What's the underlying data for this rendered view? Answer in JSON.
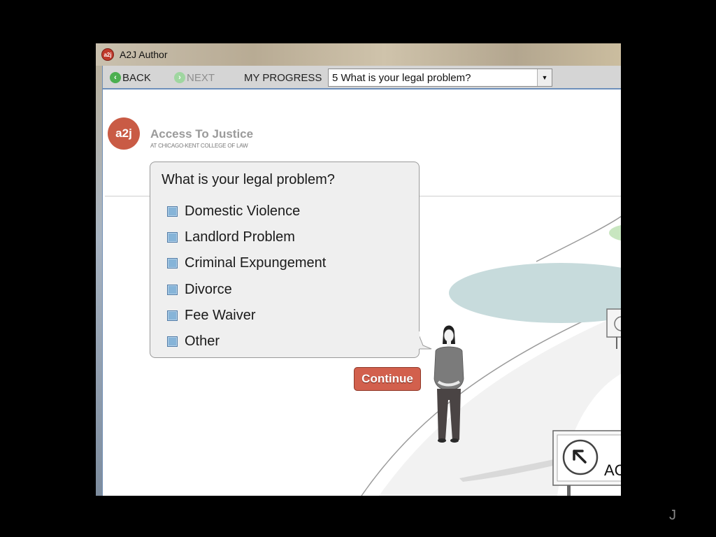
{
  "window": {
    "title": "A2J Author",
    "icon_text": "a2j"
  },
  "nav": {
    "back_label": "BACK",
    "next_label": "NEXT",
    "progress_label": "MY PROGRESS",
    "progress_value": "5 What is your legal problem?"
  },
  "brand": {
    "logo_text": "a2j",
    "title": "Access To Justice",
    "subtitle": "AT CHICAGO-KENT COLLEGE OF LAW"
  },
  "question": {
    "text": "What is your legal problem?",
    "options": [
      "Domestic Violence",
      "Landlord Problem",
      "Criminal Expungement",
      "Divorce",
      "Fee Waiver",
      "Other"
    ],
    "continue_label": "Continue"
  },
  "scene": {
    "sign_text": "AC"
  },
  "corner_text": "J",
  "colors": {
    "accent_button": "#d2604d",
    "logo": "#c95b45",
    "checkbox": "#86b4d8",
    "nav_arrow": "#4caf50"
  },
  "icons": {
    "back": "back-arrow-icon",
    "next": "next-arrow-icon",
    "dropdown": "chevron-down-icon",
    "sign": "arrow-up-left-icon"
  }
}
